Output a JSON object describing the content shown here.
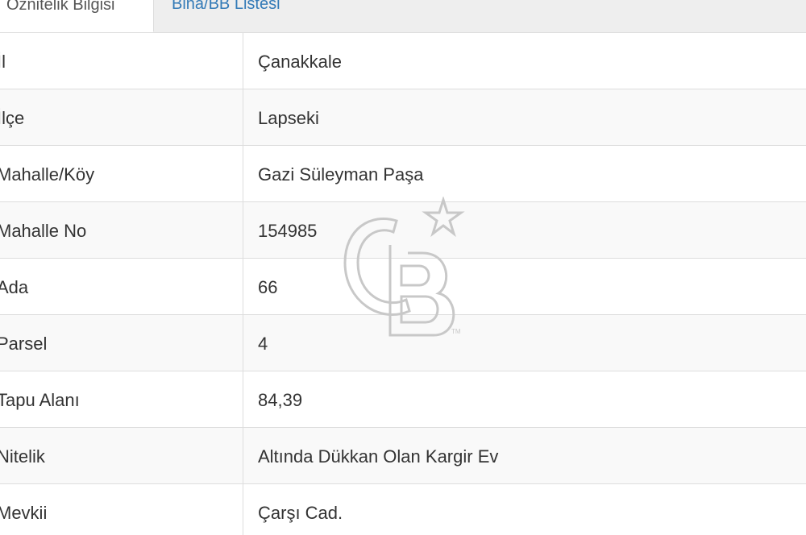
{
  "tabs": [
    {
      "label": "Özniteli̇k Bilgisi",
      "active": true
    },
    {
      "label": "Bina/BB Listesi",
      "active": false
    }
  ],
  "rows": [
    {
      "label": "İl",
      "value": "Çanakkale"
    },
    {
      "label": "İlçe",
      "value": "Lapseki"
    },
    {
      "label": "Mahalle/Köy",
      "value": "Gazi Süleyman Paşa"
    },
    {
      "label": "Mahalle No",
      "value": "154985"
    },
    {
      "label": "Ada",
      "value": "66"
    },
    {
      "label": "Parsel",
      "value": "4"
    },
    {
      "label": "Tapu Alanı",
      "value": "84,39"
    },
    {
      "label": "Nitelik",
      "value": "Altında Dükkan Olan Kargir Ev"
    },
    {
      "label": "Mevkii",
      "value": "Çarşı Cad."
    }
  ],
  "watermark": {
    "logo": "CB",
    "mark": "TM",
    "icon": "star-icon"
  },
  "colors": {
    "tab_bar_bg": "#eeeeee",
    "link": "#337ab7",
    "text": "#333333",
    "border": "#dddddd",
    "stripe": "#f9f9f9",
    "watermark": "#c8c8c8"
  }
}
